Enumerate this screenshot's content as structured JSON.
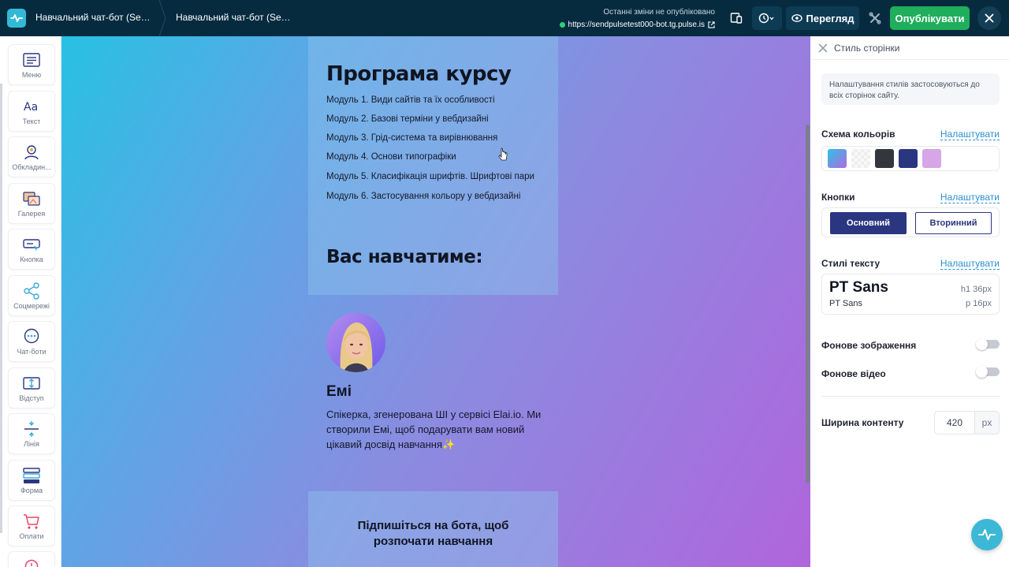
{
  "topbar": {
    "breadcrumb_1": "Навчальний чат-бот (Sendp...",
    "breadcrumb_2": "Навчальний чат-бот (Sendp...",
    "status_text": "Останні зміни не опубліковано",
    "site_url": "https://sendpulsetest000-bot.tg.pulse.is",
    "preview_label": "Перегляд",
    "publish_label": "Опублікувати"
  },
  "sidebar": {
    "items": [
      {
        "label": "Меню",
        "icon": "menu-icon"
      },
      {
        "label": "Текст",
        "icon": "text-icon"
      },
      {
        "label": "Обкладин...",
        "icon": "cover-icon"
      },
      {
        "label": "Галерея",
        "icon": "gallery-icon"
      },
      {
        "label": "Кнопка",
        "icon": "button-icon"
      },
      {
        "label": "Соцмережі",
        "icon": "share-icon"
      },
      {
        "label": "Чат-боти",
        "icon": "chat-icon"
      },
      {
        "label": "Відступ",
        "icon": "spacing-icon"
      },
      {
        "label": "Лінія",
        "icon": "line-icon"
      },
      {
        "label": "Форма",
        "icon": "form-icon"
      },
      {
        "label": "Оплати",
        "icon": "cart-icon"
      }
    ]
  },
  "canvas": {
    "program_title": "Програма курсу",
    "modules": [
      "Модуль 1. Види сайтів та їх особливості",
      "Модуль 2. Базові терміни у вебдизайні",
      "Модуль 3. Грід-система та вирівнювання",
      "Модуль 4. Основи типографіки",
      "Модуль 5. Класифікація шрифтів. Шрифтові пари",
      "Модуль 6. Застосування кольору у вебдизайні"
    ],
    "teachers_title": "Вас навчатиме:",
    "teacher_name": "Емі",
    "teacher_desc": "Спікерка, згенерована ШІ у сервісі Elai.io. Ми створили Емі, щоб подарувати вам новий цікавий досвід навчання✨",
    "cta_text": "Підпишіться на бота, щоб розпочати навчання"
  },
  "panel": {
    "title": "Стиль сторінки",
    "note": "Налаштування стилів застосовуються до всіх сторінок сайту.",
    "color_scheme_label": "Схема кольорів",
    "configure_label": "Налаштувати",
    "swatch_colors": [
      "#4ea9e8",
      "#f2f2f2",
      "#34363d",
      "#2b3680",
      "#d6a6e6"
    ],
    "buttons_label": "Кнопки",
    "primary_btn": "Основний",
    "secondary_btn": "Вторинний",
    "text_styles_label": "Стилі тексту",
    "h1_font": "PT Sans",
    "h1_meta": "h1  36px",
    "p_font": "PT Sans",
    "p_meta": "p  16px",
    "bg_image_label": "Фонове зображення",
    "bg_image_on": false,
    "bg_video_label": "Фонове відео",
    "bg_video_on": false,
    "content_width_label": "Ширина контенту",
    "content_width_value": "420",
    "content_width_unit": "px"
  }
}
